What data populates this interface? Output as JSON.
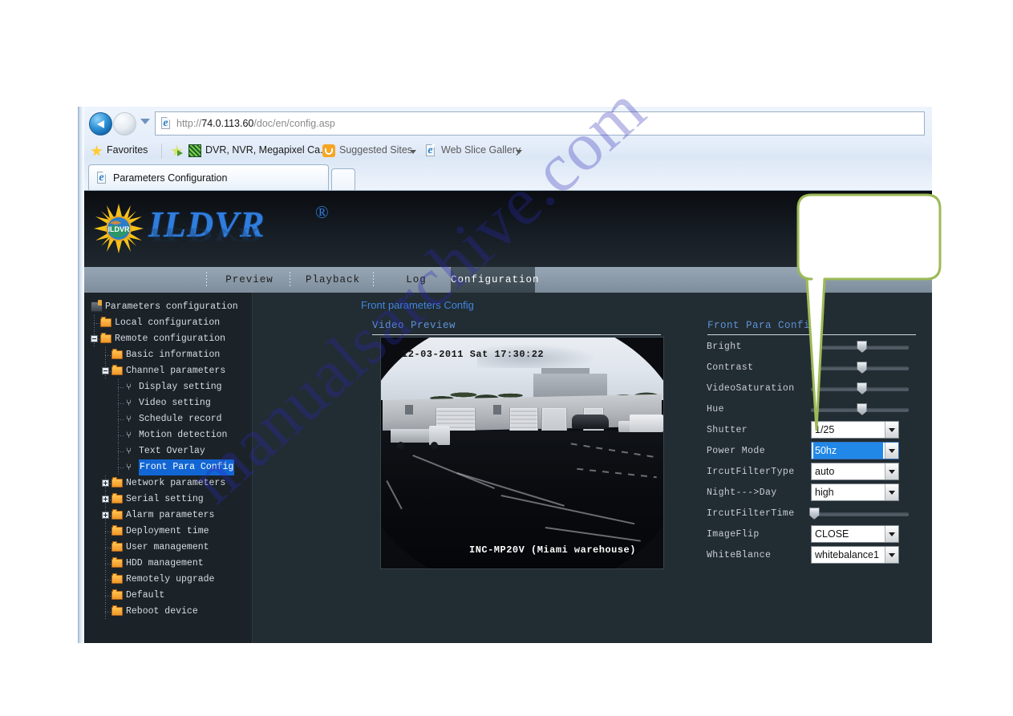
{
  "browser": {
    "url_protocol": "http://",
    "url_host": "74.0.113.60",
    "url_path": "/doc/en/config.asp",
    "favorites_label": "Favorites",
    "fav_items": [
      {
        "label": "DVR, NVR, Megapixel Ca...",
        "icon": "site-icon"
      },
      {
        "label": "Suggested Sites",
        "icon": "suggested-sites-icon"
      },
      {
        "label": "Web Slice Gallery",
        "icon": "web-slice-icon"
      }
    ],
    "tab_title": "Parameters Configuration"
  },
  "app": {
    "logo_text": "ILDVR",
    "logo_mark": "®",
    "logo_badge": "ILDVR",
    "nav_tabs": [
      {
        "label": "Preview",
        "active": false
      },
      {
        "label": "Playback",
        "active": false
      },
      {
        "label": "Log",
        "active": false
      },
      {
        "label": "Configuration",
        "active": true
      }
    ],
    "page_title": "Front parameters Config"
  },
  "sidebar": {
    "items": [
      {
        "label": "Parameters configuration",
        "depth": 0,
        "icon": "root-icon",
        "toggle": "none",
        "selected": false
      },
      {
        "label": "Local configuration",
        "depth": 1,
        "icon": "folder-icon",
        "toggle": "none",
        "selected": false
      },
      {
        "label": "Remote configuration",
        "depth": 1,
        "icon": "folder-icon",
        "toggle": "collapse",
        "selected": false
      },
      {
        "label": "Basic information",
        "depth": 2,
        "icon": "folder-icon",
        "toggle": "none",
        "selected": false
      },
      {
        "label": "Channel parameters",
        "depth": 2,
        "icon": "folder-icon",
        "toggle": "collapse",
        "selected": false
      },
      {
        "label": "Display setting",
        "depth": 3,
        "icon": "wrench-icon",
        "toggle": "none",
        "selected": false
      },
      {
        "label": "Video setting",
        "depth": 3,
        "icon": "wrench-icon",
        "toggle": "none",
        "selected": false
      },
      {
        "label": "Schedule record",
        "depth": 3,
        "icon": "wrench-icon",
        "toggle": "none",
        "selected": false
      },
      {
        "label": "Motion detection",
        "depth": 3,
        "icon": "wrench-icon",
        "toggle": "none",
        "selected": false
      },
      {
        "label": "Text Overlay",
        "depth": 3,
        "icon": "wrench-icon",
        "toggle": "none",
        "selected": false
      },
      {
        "label": "Front Para Config",
        "depth": 3,
        "icon": "wrench-icon",
        "toggle": "none",
        "selected": true
      },
      {
        "label": "Network parameters",
        "depth": 2,
        "icon": "folder-icon",
        "toggle": "expand",
        "selected": false
      },
      {
        "label": "Serial setting",
        "depth": 2,
        "icon": "folder-icon",
        "toggle": "expand",
        "selected": false
      },
      {
        "label": "Alarm parameters",
        "depth": 2,
        "icon": "folder-icon",
        "toggle": "expand",
        "selected": false
      },
      {
        "label": "Deployment time",
        "depth": 2,
        "icon": "folder-icon",
        "toggle": "none",
        "selected": false
      },
      {
        "label": "User management",
        "depth": 2,
        "icon": "folder-icon",
        "toggle": "none",
        "selected": false
      },
      {
        "label": "HDD management",
        "depth": 2,
        "icon": "folder-icon",
        "toggle": "none",
        "selected": false
      },
      {
        "label": "Remotely upgrade",
        "depth": 2,
        "icon": "folder-icon",
        "toggle": "none",
        "selected": false
      },
      {
        "label": "Default",
        "depth": 2,
        "icon": "folder-icon",
        "toggle": "none",
        "selected": false
      },
      {
        "label": "Reboot device",
        "depth": 2,
        "icon": "folder-icon",
        "toggle": "none",
        "selected": false
      }
    ]
  },
  "video_preview": {
    "section_title": "Video Preview",
    "osd_timestamp": "12-03-2011 Sat 17:30:22",
    "osd_camera_name": "INC-MP20V (Miami warehouse)"
  },
  "front_para": {
    "section_title": "Front Para Config",
    "rows": [
      {
        "label": "Bright",
        "control": "slider",
        "thumb_pct": 52
      },
      {
        "label": "Contrast",
        "control": "slider",
        "thumb_pct": 52
      },
      {
        "label": "VideoSaturation",
        "control": "slider",
        "thumb_pct": 52
      },
      {
        "label": "Hue",
        "control": "slider",
        "thumb_pct": 52
      },
      {
        "label": "Shutter",
        "control": "select",
        "value": "1/25",
        "highlighted": false
      },
      {
        "label": "Power Mode",
        "control": "select",
        "value": "50hz",
        "highlighted": true
      },
      {
        "label": "IrcutFilterType",
        "control": "select",
        "value": "auto",
        "highlighted": false
      },
      {
        "label": "Night--->Day",
        "control": "select",
        "value": "high",
        "highlighted": false
      },
      {
        "label": "IrcutFilterTime",
        "control": "slider",
        "thumb_pct": 3
      },
      {
        "label": "ImageFlip",
        "control": "select",
        "value": "CLOSE",
        "highlighted": false
      },
      {
        "label": "WhiteBlance",
        "control": "select",
        "value": "whitebalance1",
        "highlighted": false
      }
    ]
  },
  "callout": {
    "text": "",
    "border_color": "#9cba56",
    "fill_color": "#ffffff"
  },
  "watermark": {
    "text": "manualsarchive.com",
    "color": "#2a2ab8"
  },
  "colors": {
    "panel_bg": "#222c33",
    "sidebar_bg": "#1b2329",
    "accent_blue": "#3f86e0",
    "selection_blue": "#1266d4",
    "highlight_blue": "#2288e8",
    "navbar_gray": "#8b9aa8",
    "logo_blue": "#2f7ddd"
  }
}
